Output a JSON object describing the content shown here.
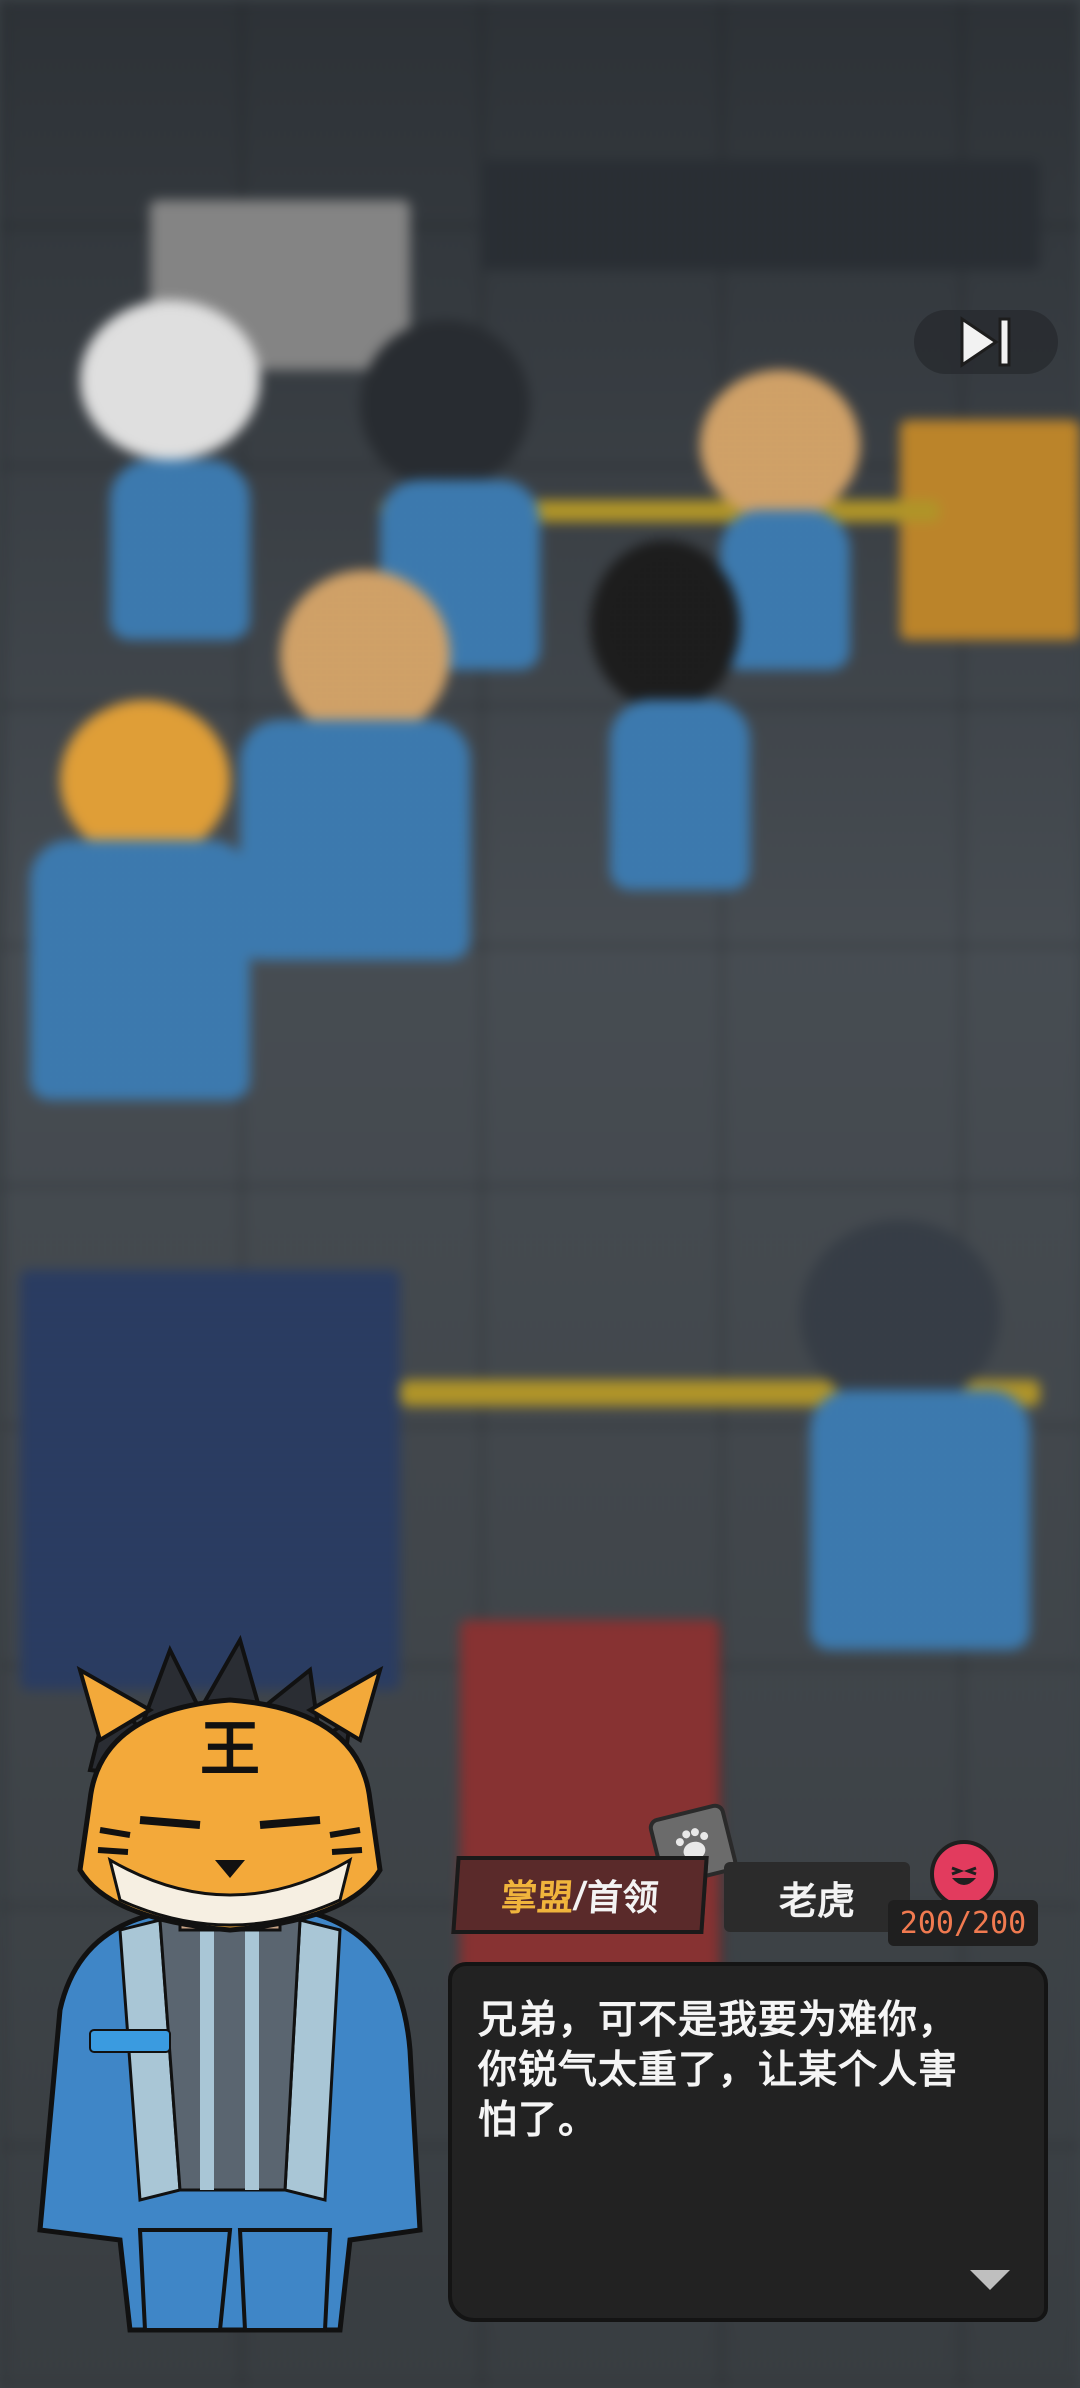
{
  "controls": {
    "skip_icon": "skip-forward-icon"
  },
  "speaker": {
    "title_prefix": "掌盟",
    "title_sep": "/",
    "title_suffix": "首领",
    "name": "老虎",
    "mood_icon": "laughing-face-icon",
    "mood_value": "200/200",
    "head_mark": "王"
  },
  "dialog": {
    "text": "兄弟，可不是我要为难你，\n你锐气太重了，让某个人害\n怕了。",
    "more_icon": "triangle-down-icon"
  },
  "colors": {
    "accent_gold": "#f0b43c",
    "mood_red": "#e23b5e",
    "mood_text": "#f07a50"
  }
}
